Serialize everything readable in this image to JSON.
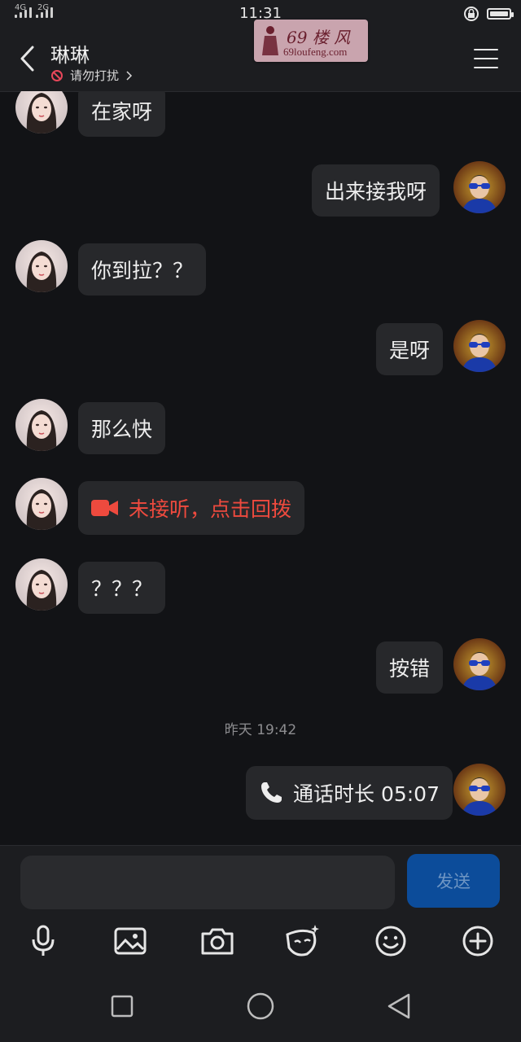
{
  "status_bar": {
    "network": "4G",
    "network2": "2G",
    "time": "11:31"
  },
  "header": {
    "contact_name": "琳琳",
    "status": "请勿打扰"
  },
  "watermark": {
    "line1": "69 楼 风",
    "line2": "69loufeng.com"
  },
  "messages": [
    {
      "sender": "them",
      "text": "在家呀"
    },
    {
      "sender": "me",
      "text": "出来接我呀"
    },
    {
      "sender": "them",
      "text": "你到拉？？"
    },
    {
      "sender": "me",
      "text": "是呀"
    },
    {
      "sender": "them",
      "text": "那么快"
    },
    {
      "sender": "them",
      "text": "未接听，点击回拨",
      "icon": "video-camera-icon",
      "color": "#ee4a3e"
    },
    {
      "sender": "them",
      "text": "？？？"
    },
    {
      "sender": "me",
      "text": "按错"
    },
    {
      "sender": "me",
      "text": "通话时长 05:07",
      "icon": "phone-icon"
    }
  ],
  "timestamp": "昨天 19:42",
  "input": {
    "value": "",
    "send_label": "发送"
  },
  "toolbar": [
    "microphone-icon",
    "image-icon",
    "camera-icon",
    "sticker-icon",
    "emoji-icon",
    "add-icon"
  ],
  "colors": {
    "background": "#121316",
    "bubble": "#27282b",
    "send_button": "#0c4c9a",
    "missed_call": "#ee4a3e"
  }
}
